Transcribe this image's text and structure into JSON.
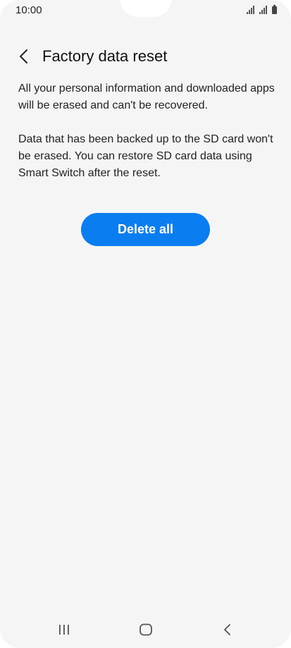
{
  "status_bar": {
    "time": "10:00",
    "icons": [
      "signal-icon",
      "signal-icon",
      "battery-icon"
    ]
  },
  "header": {
    "back_icon": "chevron-left-icon",
    "title": "Factory data reset"
  },
  "content": {
    "paragraph_1": "All your personal information and downloaded apps will be erased and can't be recovered.",
    "paragraph_2": "Data that has been backed up to the SD card won't be erased. You can restore SD card data using Smart Switch after the reset."
  },
  "actions": {
    "delete_all_label": "Delete all",
    "accent_color": "#0a7df0"
  },
  "nav_bar": {
    "items": [
      "recent-apps-icon",
      "home-icon",
      "back-icon"
    ]
  }
}
